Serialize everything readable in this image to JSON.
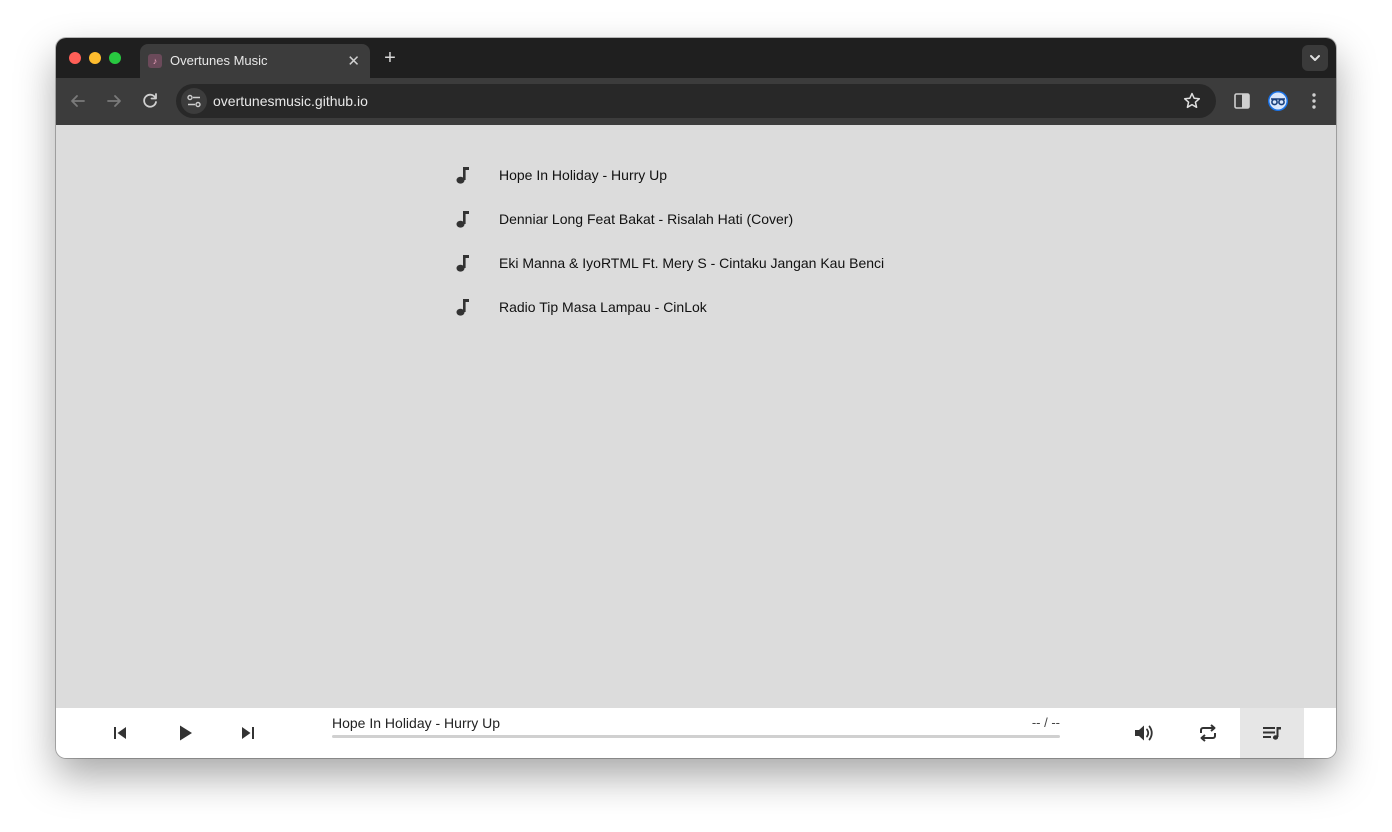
{
  "browser": {
    "tab_title": "Overtunes Music",
    "tab_close": "✕",
    "new_tab": "+",
    "url": "overtunesmusic.github.io"
  },
  "playlist": {
    "tracks": [
      {
        "title": "Hope In Holiday - Hurry Up"
      },
      {
        "title": "Denniar Long Feat Bakat - Risalah Hati (Cover)"
      },
      {
        "title": "Eki Manna & IyoRTML Ft. Mery S - Cintaku Jangan Kau Benci"
      },
      {
        "title": "Radio Tip Masa Lampau - CinLok"
      }
    ]
  },
  "player": {
    "now_playing": "Hope In Holiday - Hurry Up",
    "time": "-- / --",
    "progress": 0
  },
  "colors": {
    "content_bg": "#dcdcdc",
    "player_bg": "#ffffff",
    "icon": "#333333"
  }
}
